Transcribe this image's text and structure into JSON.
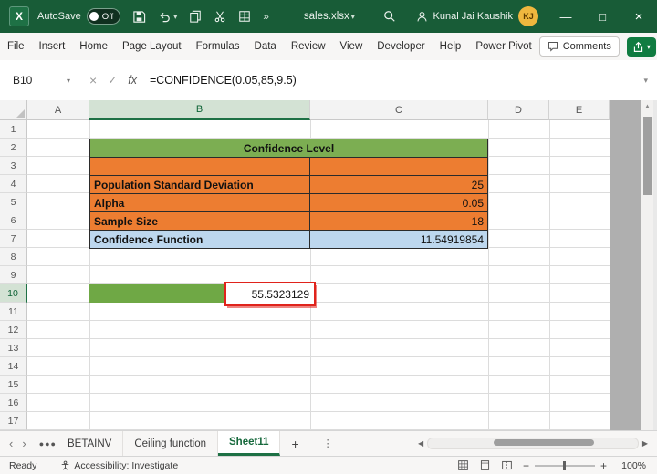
{
  "colors": {
    "titlebar_green": "#185C37",
    "accent_green": "#217346",
    "share_green": "#107C41",
    "table_header_green": "#7CAE52",
    "table_orange": "#ED7D31",
    "table_blue": "#BDD7EE",
    "result_cell_green": "#6FA845",
    "annotation_red": "#E0231C",
    "selected_header_bg": "#D3E2D4"
  },
  "glyphs": {
    "logo_letter": "X",
    "caret_down": "▾",
    "chevron_double": "»",
    "cancel": "×",
    "check": "✓",
    "minimize": "—",
    "maximize": "□",
    "close": "×",
    "nav_left": "‹",
    "nav_right": "›",
    "overflow": "●●●",
    "vdots": "⋮",
    "plus": "+",
    "scroll_left": "◀",
    "scroll_right": "▶",
    "scroll_up": "▲",
    "zoom_out": "−",
    "zoom_in": "+"
  },
  "title_bar": {
    "autosave_label": "AutoSave",
    "autosave_state": "Off",
    "filename": "sales.xlsx",
    "user_name": "Kunal Jai Kaushik",
    "user_initials": "KJ"
  },
  "ribbon": {
    "tabs": [
      "File",
      "Insert",
      "Home",
      "Page Layout",
      "Formulas",
      "Data",
      "Review",
      "View",
      "Developer",
      "Help",
      "Power Pivot"
    ],
    "comments_label": "Comments"
  },
  "formula_bar": {
    "name_box_value": "B10",
    "fx_label": "fx",
    "formula": "=CONFIDENCE(0.05,85,9.5)"
  },
  "grid": {
    "column_headers": [
      "A",
      "B",
      "C",
      "D",
      "E"
    ],
    "selected_column": "B",
    "row_numbers": [
      "1",
      "2",
      "3",
      "4",
      "5",
      "6",
      "7",
      "8",
      "9",
      "10",
      "11",
      "12",
      "13",
      "14",
      "15",
      "16",
      "17"
    ],
    "selected_row": "10"
  },
  "table": {
    "title": "Confidence Level",
    "rows": [
      {
        "label": "Population Standard Deviation",
        "value": "25"
      },
      {
        "label": "Alpha",
        "value": "0.05"
      },
      {
        "label": "Sample Size",
        "value": "18"
      }
    ],
    "result_row": {
      "label": "Confidence Function",
      "value": "11.54919854"
    }
  },
  "highlight_cell": {
    "cell": "B10",
    "value": "55.5323129"
  },
  "sheet_tabs": {
    "tabs": [
      "BETAINV",
      "Ceiling function",
      "Sheet11"
    ],
    "active_tab": "Sheet11"
  },
  "status_bar": {
    "mode": "Ready",
    "accessibility": "Accessibility: Investigate",
    "zoom_level": "100%"
  }
}
